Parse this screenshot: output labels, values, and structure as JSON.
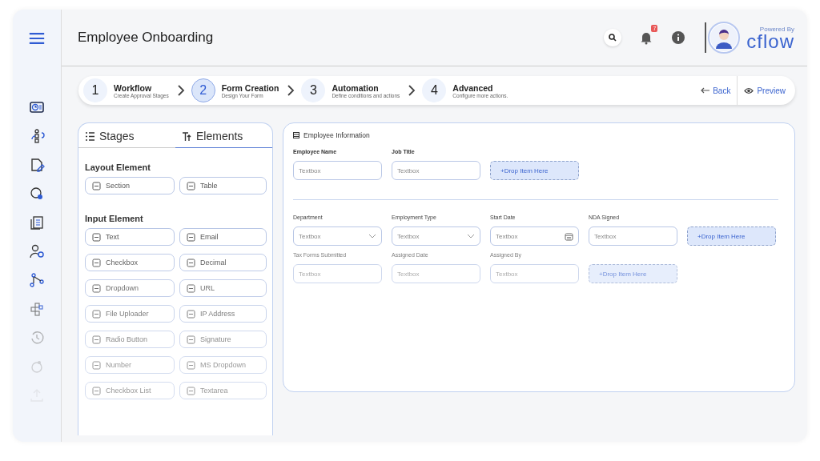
{
  "header": {
    "title": "Employee Onboarding",
    "notification_count": "7",
    "brand_tagline": "Powered By",
    "brand_name": "cflow"
  },
  "steps": [
    {
      "number": "1",
      "title": "Workflow",
      "subtitle": "Create Approval Stages",
      "selected": false
    },
    {
      "number": "2",
      "title": "Form Creation",
      "subtitle": "Design Your Form",
      "selected": true
    },
    {
      "number": "3",
      "title": "Automation",
      "subtitle": "Define conditions and actions",
      "selected": false
    },
    {
      "number": "4",
      "title": "Advanced",
      "subtitle": "Configure more actions.",
      "selected": false
    }
  ],
  "actions": {
    "back": "Back",
    "preview": "Preview"
  },
  "panel_tabs": [
    {
      "label": "Stages",
      "selected": false
    },
    {
      "label": "Elements",
      "selected": true
    }
  ],
  "layout_elements": {
    "heading": "Layout Element",
    "items": [
      "Section",
      "Table"
    ]
  },
  "input_elements": {
    "heading": "Input Element",
    "items": [
      "Text",
      "Email",
      "Checkbox",
      "Decimal",
      "Dropdown",
      "URL",
      "File Uploader",
      "IP Address",
      "Radio Button",
      "Signature",
      "Number",
      "MS Dropdown",
      "Checkbox List",
      "Textarea"
    ]
  },
  "section": {
    "title": "Employee Information",
    "groups": [
      {
        "rows": [
          [
            {
              "kind": "text",
              "label": "Employee Name",
              "placeholder": "Textbox"
            },
            {
              "kind": "text",
              "label": "Job Title",
              "placeholder": "Textbox"
            },
            {
              "kind": "drop",
              "text": "+Drop Item Here"
            }
          ]
        ]
      },
      {
        "rows": [
          [
            {
              "kind": "dropdown",
              "label": "Department",
              "placeholder": "Textbox"
            },
            {
              "kind": "dropdown",
              "label": "Employment Type",
              "placeholder": "Textbox"
            },
            {
              "kind": "date",
              "label": "Start Date",
              "placeholder": "Textbox"
            },
            {
              "kind": "text",
              "label": "NDA Signed",
              "placeholder": "Textbox"
            },
            {
              "kind": "drop",
              "text": "+Drop Item Here"
            }
          ],
          [
            {
              "kind": "text",
              "label": "Tax Forms Submitted",
              "placeholder": "Textbox"
            },
            {
              "kind": "text",
              "label": "Assigned Date",
              "placeholder": "Textbox"
            },
            {
              "kind": "text",
              "label": "Assigned By",
              "placeholder": "Textbox"
            },
            {
              "kind": "drop",
              "text": "+Drop Item Here"
            }
          ]
        ]
      }
    ]
  }
}
